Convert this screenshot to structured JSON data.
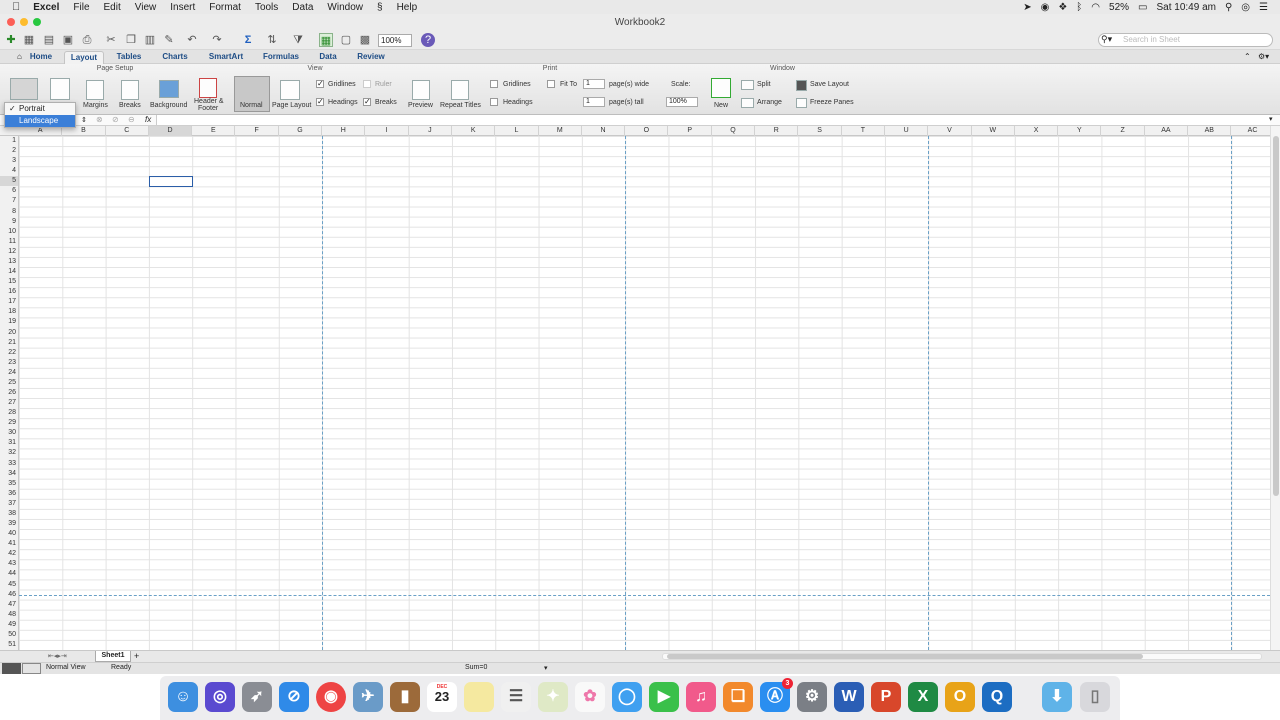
{
  "menubar": {
    "apple": "",
    "app": "Excel",
    "items": [
      "File",
      "Edit",
      "View",
      "Insert",
      "Format",
      "Tools",
      "Data",
      "Window",
      "Help"
    ],
    "battery": "52%",
    "clock": "Sat 10:49 am"
  },
  "window": {
    "title": "Workbook2"
  },
  "toolbar": {
    "zoom": "100%",
    "search_placeholder": "Search in Sheet"
  },
  "tabs": [
    "Home",
    "Layout",
    "Tables",
    "Charts",
    "SmartArt",
    "Formulas",
    "Data",
    "Review"
  ],
  "ribbon": {
    "groups": {
      "page_setup": "Page Setup",
      "view": "View",
      "print": "Print",
      "window": "Window"
    },
    "margins": "Margins",
    "breaks": "Breaks",
    "background": "Background",
    "header_footer": [
      "Header &",
      "Footer"
    ],
    "normal": "Normal",
    "page_layout": "Page Layout",
    "gridlines": "Gridlines",
    "ruler": "Ruler",
    "headings": "Headings",
    "breaks_chk": "Breaks",
    "preview": "Preview",
    "repeat_titles": "Repeat Titles",
    "print_gridlines": "Gridlines",
    "print_headings": "Headings",
    "fit_to": "Fit To",
    "fit_wide": "1",
    "fit_tall": "1",
    "pages_wide": "page(s) wide",
    "pages_tall": "page(s) tall",
    "scale_label": "Scale:",
    "scale": "100%",
    "new": "New",
    "split": "Split",
    "arrange": "Arrange",
    "save_layout": "Save Layout",
    "freeze_panes": "Freeze Panes"
  },
  "orientation_menu": {
    "options": [
      "Portrait",
      "Landscape"
    ],
    "selected": "Landscape"
  },
  "formula": {
    "fx": "fx"
  },
  "columns": [
    "A",
    "B",
    "C",
    "D",
    "E",
    "F",
    "G",
    "H",
    "I",
    "J",
    "K",
    "L",
    "M",
    "N",
    "O",
    "P",
    "Q",
    "R",
    "S",
    "T",
    "U",
    "V",
    "W",
    "X",
    "Y",
    "Z",
    "AA",
    "AB",
    "AC"
  ],
  "row_count": 51,
  "selected_cell": {
    "column": "D",
    "row": 5
  },
  "sheet": {
    "tab": "Sheet1"
  },
  "status": {
    "view": "Normal View",
    "state": "Ready",
    "sum": "Sum=0"
  },
  "dock": {
    "calendar_month": "DEC",
    "calendar_day": "23",
    "badge": "3"
  }
}
